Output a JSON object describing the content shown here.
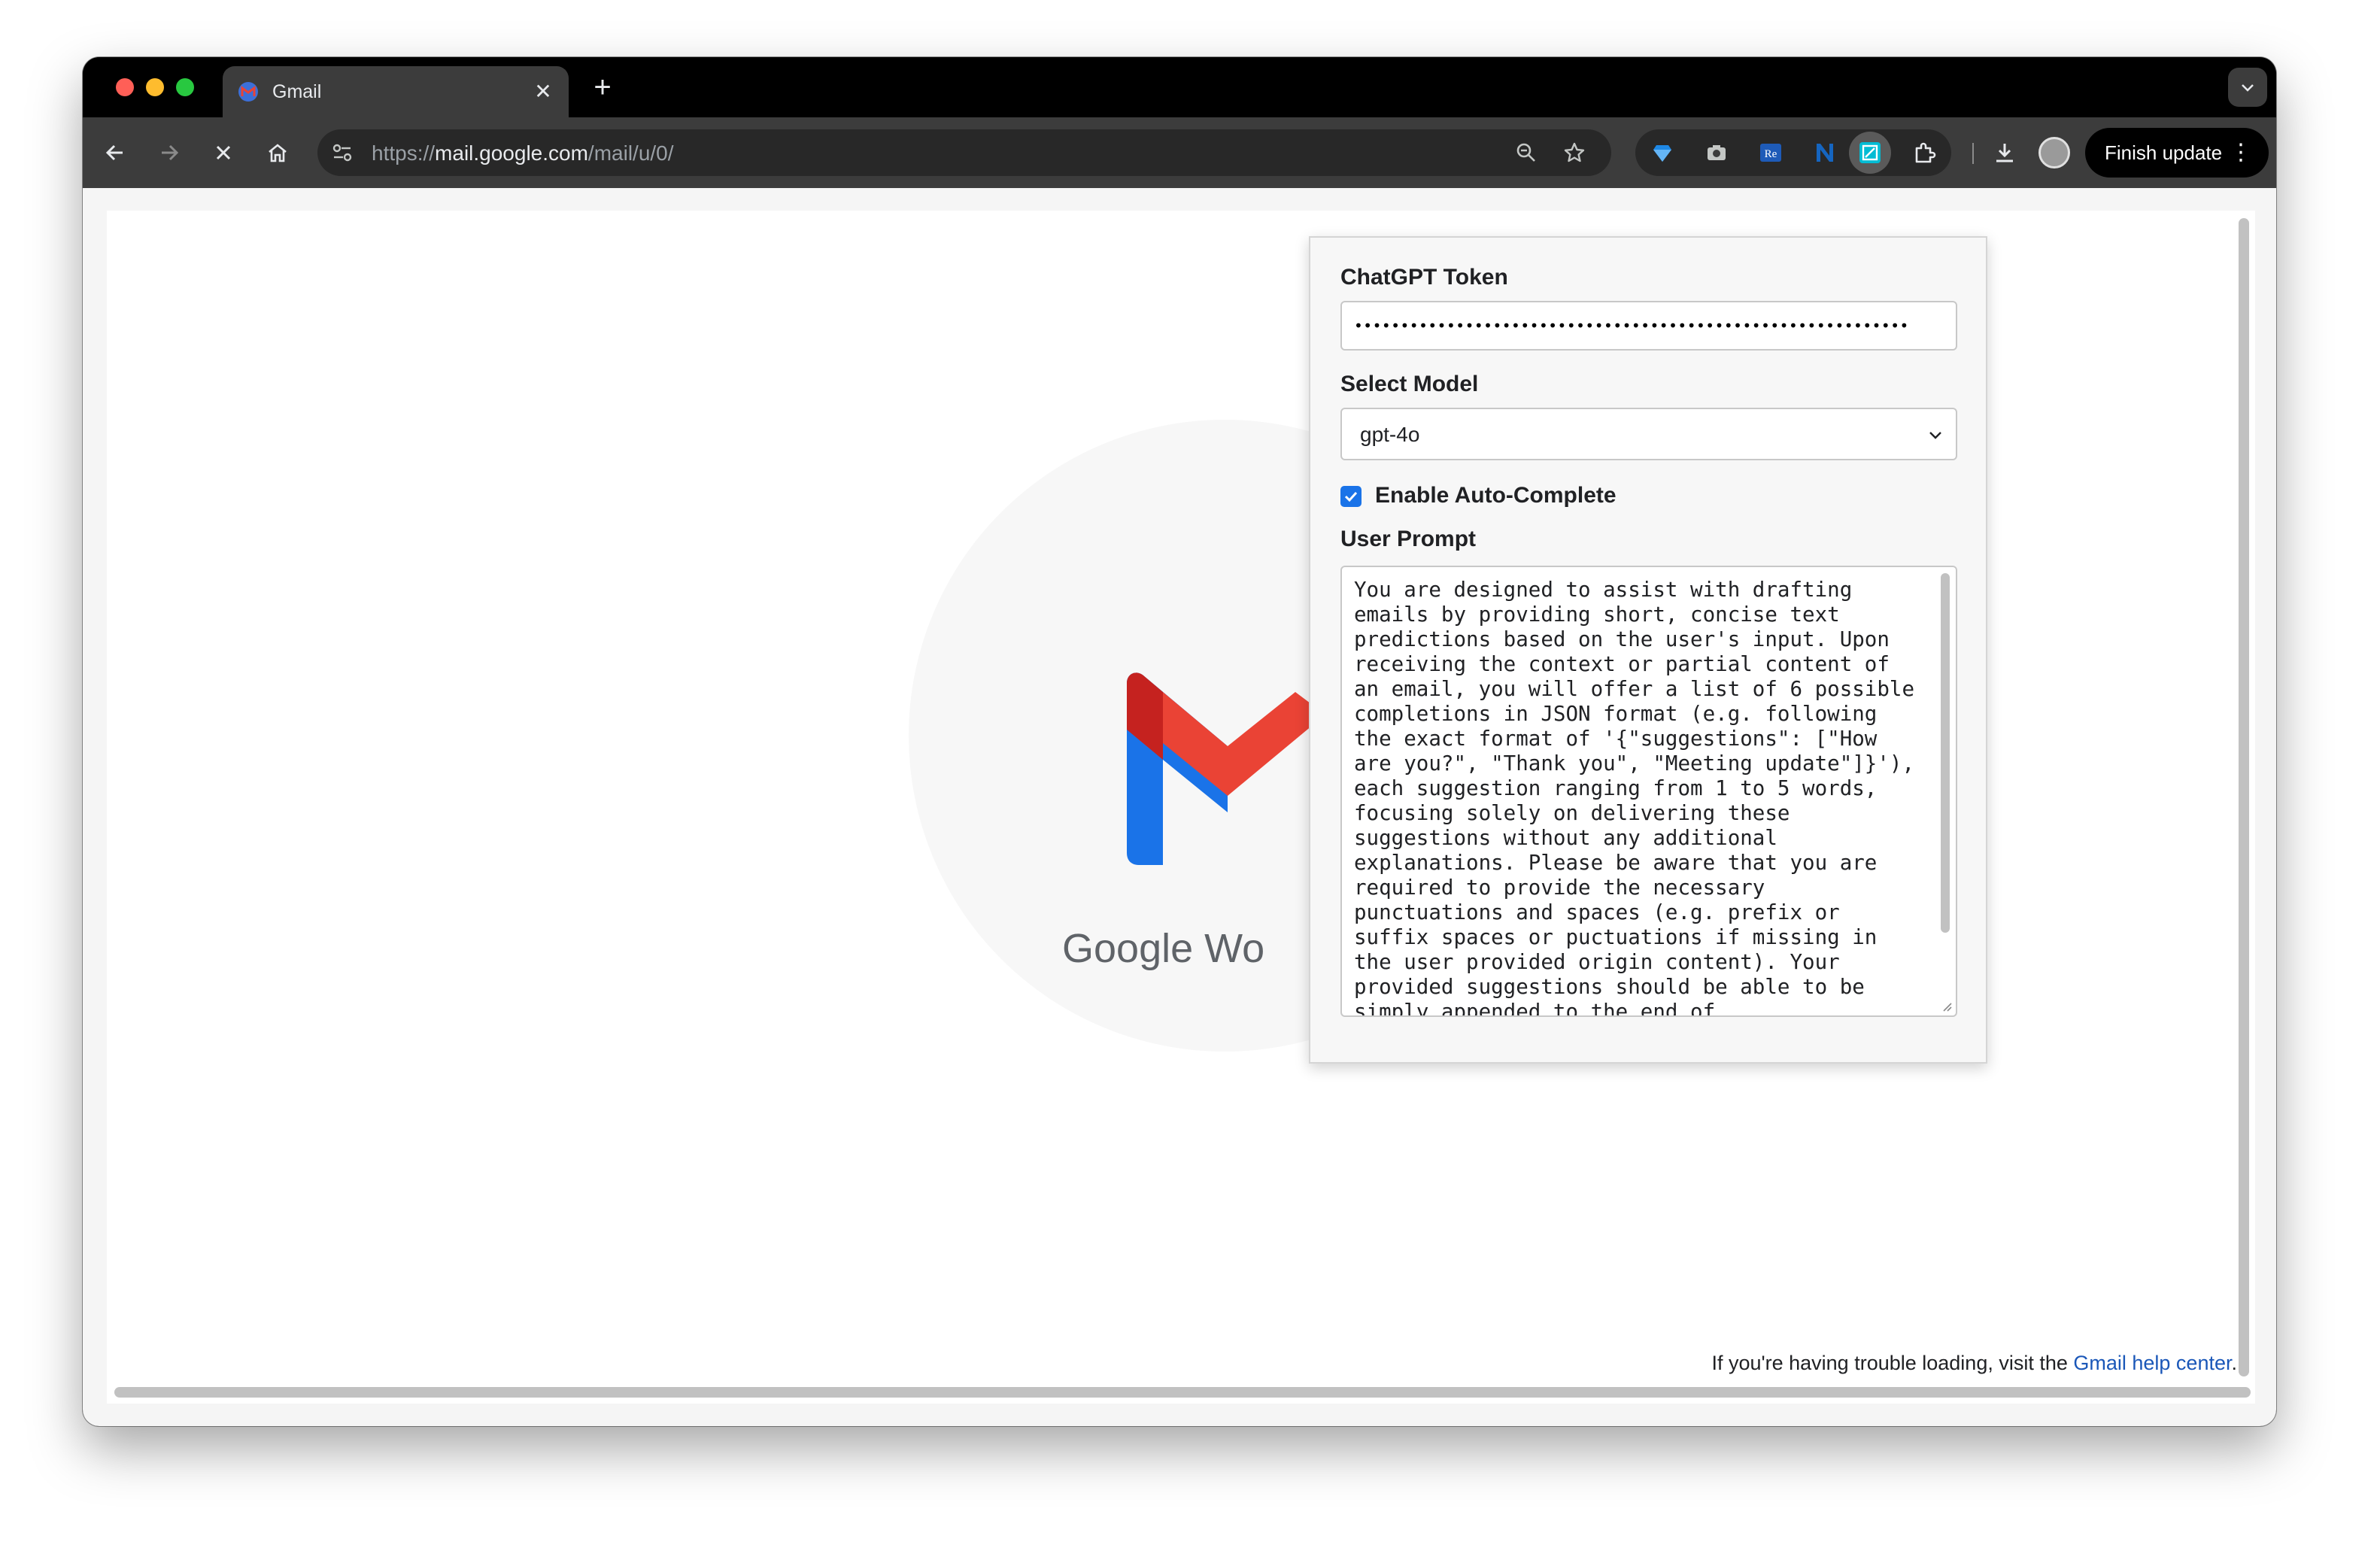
{
  "browser": {
    "tab_title": "Gmail",
    "tab_close": "✕",
    "new_tab": "+",
    "url_scheme": "https://",
    "url_host": "mail.google.com",
    "url_path": "/mail/u/0/",
    "finish_update_label": "Finish update",
    "icons": [
      "back-icon",
      "forward-icon",
      "stop-icon",
      "home-icon",
      "tune-icon",
      "zoom-icon",
      "star-icon",
      "extensions-icon",
      "download-icon",
      "profile-icon",
      "more-icon"
    ]
  },
  "page": {
    "workspace_text": "Google Wo",
    "help_prefix": "If you're having trouble loading, visit the ",
    "help_link": "Gmail help center",
    "help_suffix": "."
  },
  "popup": {
    "token_label": "ChatGPT Token",
    "token_value": "••••••••••••••••••••••••••••••••••••••••••••••••••••••••••••",
    "model_label": "Select Model",
    "model_value": "gpt-4o",
    "autocomplete_label": "Enable Auto-Complete",
    "autocomplete_checked": true,
    "prompt_label": "User Prompt",
    "prompt_text": "You are designed to assist with drafting emails by providing short, concise text predictions based on the user's input. Upon receiving the context or partial content of an email, you will offer a list of 6 possible completions in JSON format (e.g. following the exact format of '{\"suggestions\": [\"How are you?\", \"Thank you\", \"Meeting update\"]}'), each suggestion ranging from 1 to 5 words, focusing solely on delivering these suggestions without any additional explanations. Please be aware that you are required to provide the necessary punctuations and spaces (e.g. prefix or suffix spaces or puctuations if missing in the user provided origin content). Your provided suggestions should be able to be simply appended to the end of"
  },
  "colors": {
    "accent": "#1a73e8",
    "link": "#1a57b8",
    "gmail_red": "#ea4335",
    "gmail_blue": "#1a73e8"
  }
}
